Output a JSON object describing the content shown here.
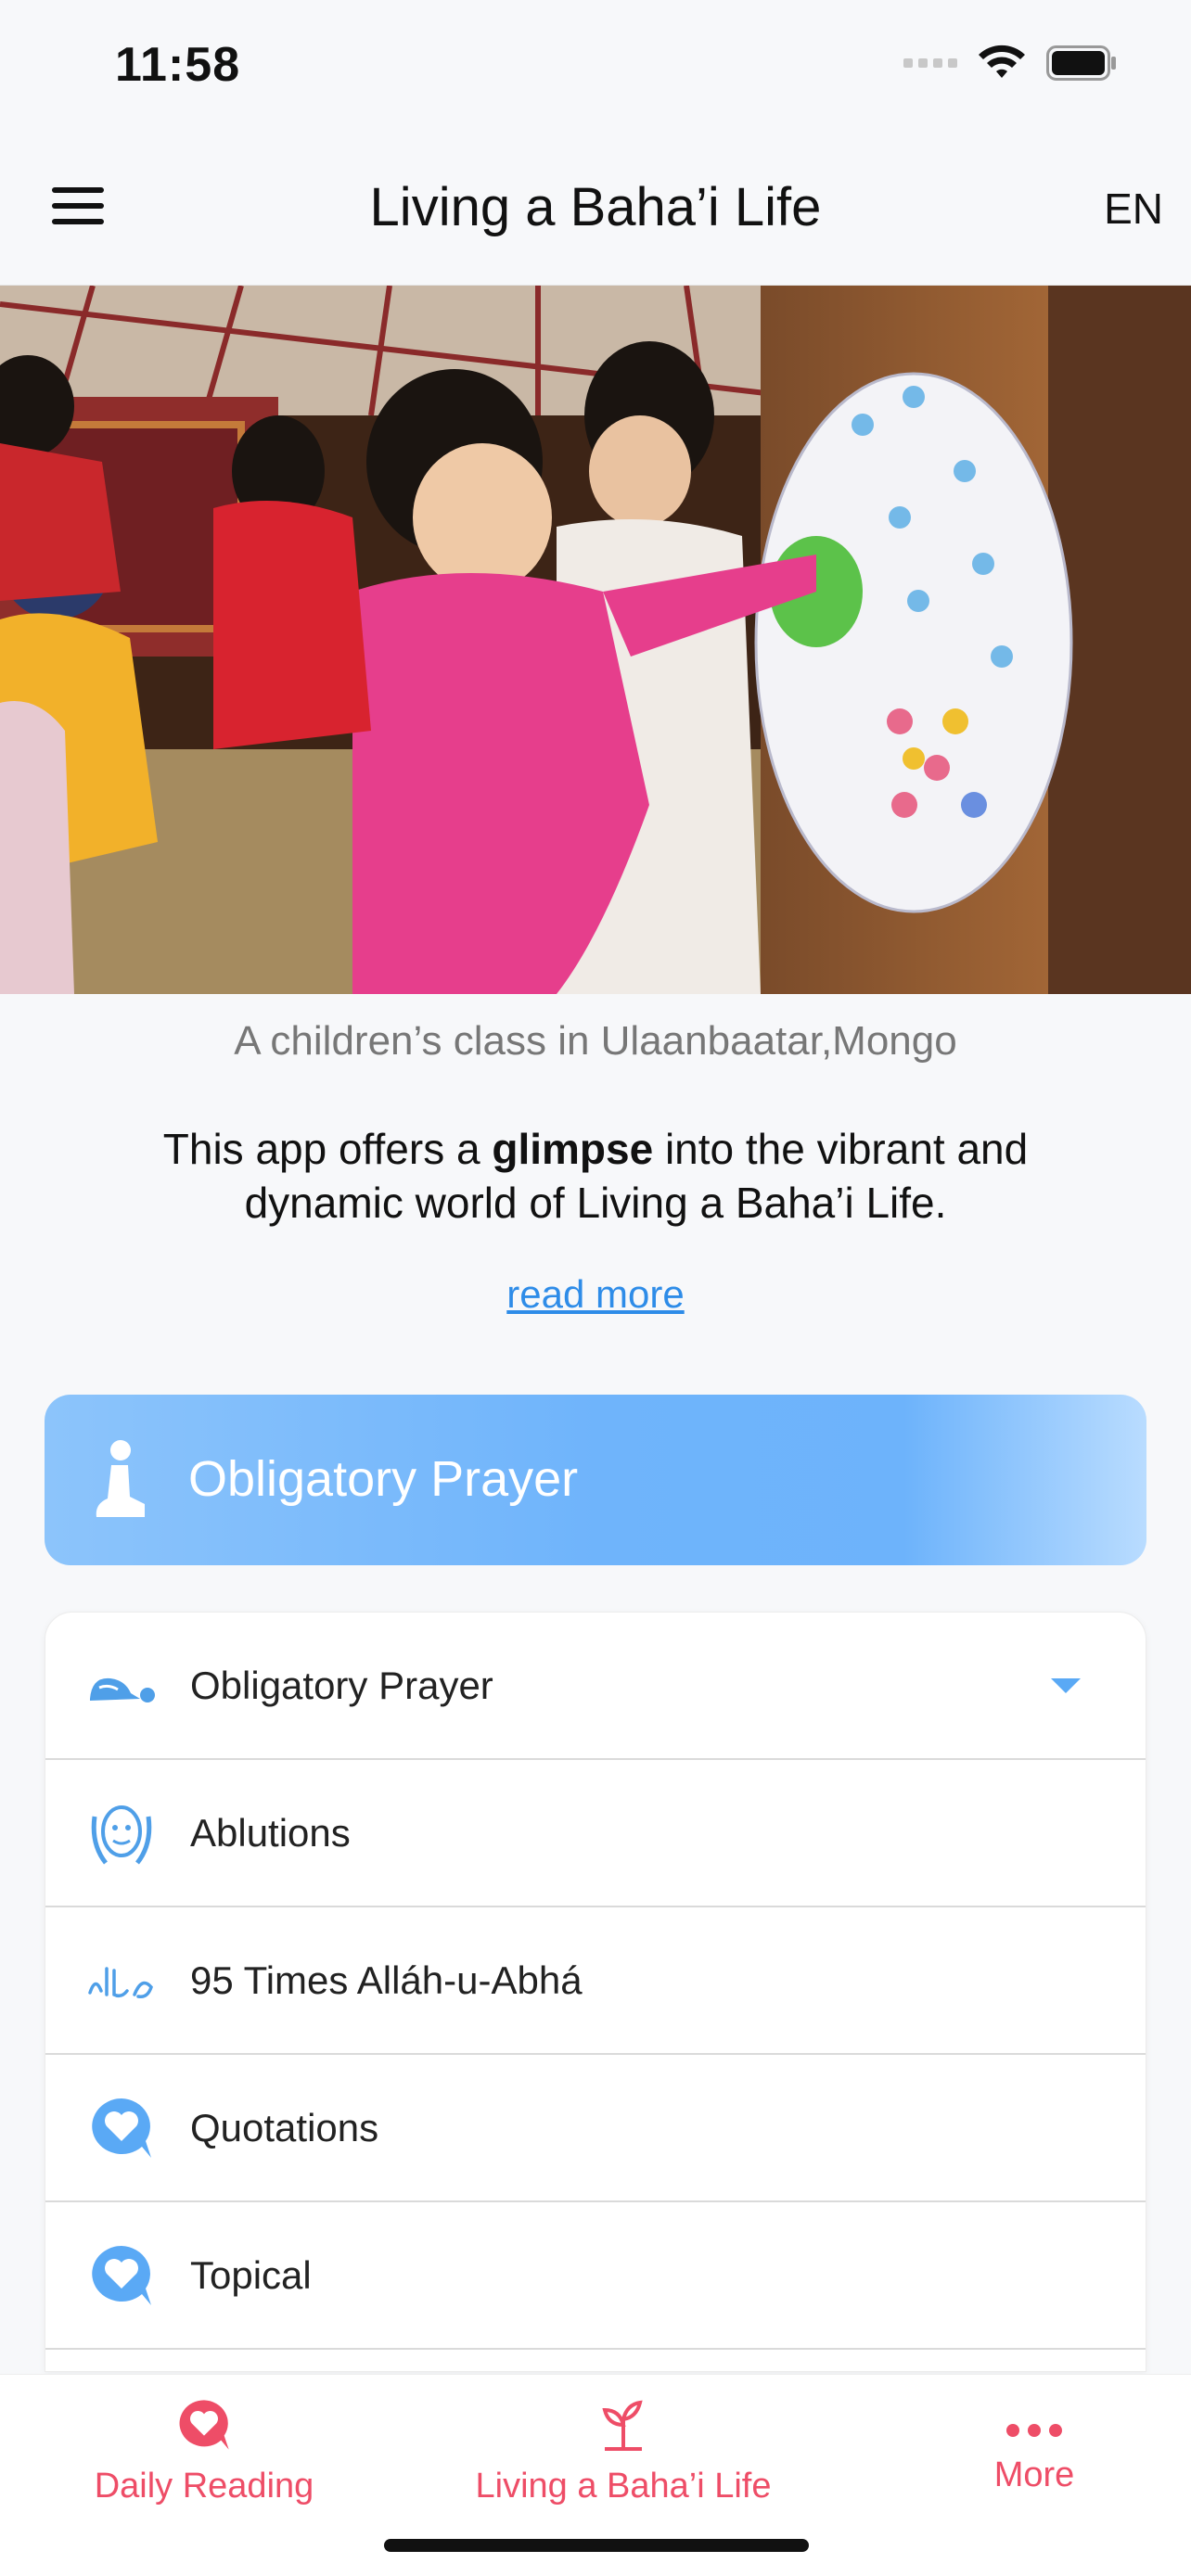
{
  "status_bar": {
    "time": "11:58"
  },
  "header": {
    "title": "Living a Baha’i Life",
    "language": "EN"
  },
  "hero": {
    "caption": "A children’s class in Ulaanbaatar,Mongo"
  },
  "intro": {
    "text_before": "This app offers a ",
    "text_bold": "glimpse",
    "text_after": " into the vibrant and dynamic world of Living a Baha’i Life."
  },
  "read_more": "read more",
  "banner": {
    "title": "Obligatory Prayer",
    "icon": "kneeling-person-icon"
  },
  "list": [
    {
      "label": "Obligatory Prayer",
      "icon": "prostration-icon",
      "expandable": true
    },
    {
      "label": "Ablutions",
      "icon": "hands-washing-face-icon"
    },
    {
      "label": "95 Times Alláh-u-Abhá",
      "icon": "calligraphy-icon"
    },
    {
      "label": "Quotations",
      "icon": "heart-bubble-icon"
    },
    {
      "label": "Topical",
      "icon": "heart-bubble-icon"
    }
  ],
  "bottom_nav": [
    {
      "label": "Daily Reading",
      "icon": "heart-bubble-icon"
    },
    {
      "label": "Living a Baha’i Life",
      "icon": "sprout-icon"
    },
    {
      "label": "More",
      "icon": "more-dots-icon"
    }
  ],
  "colors": {
    "accent": "#ee4d67",
    "blue": "#5aa9f5"
  }
}
